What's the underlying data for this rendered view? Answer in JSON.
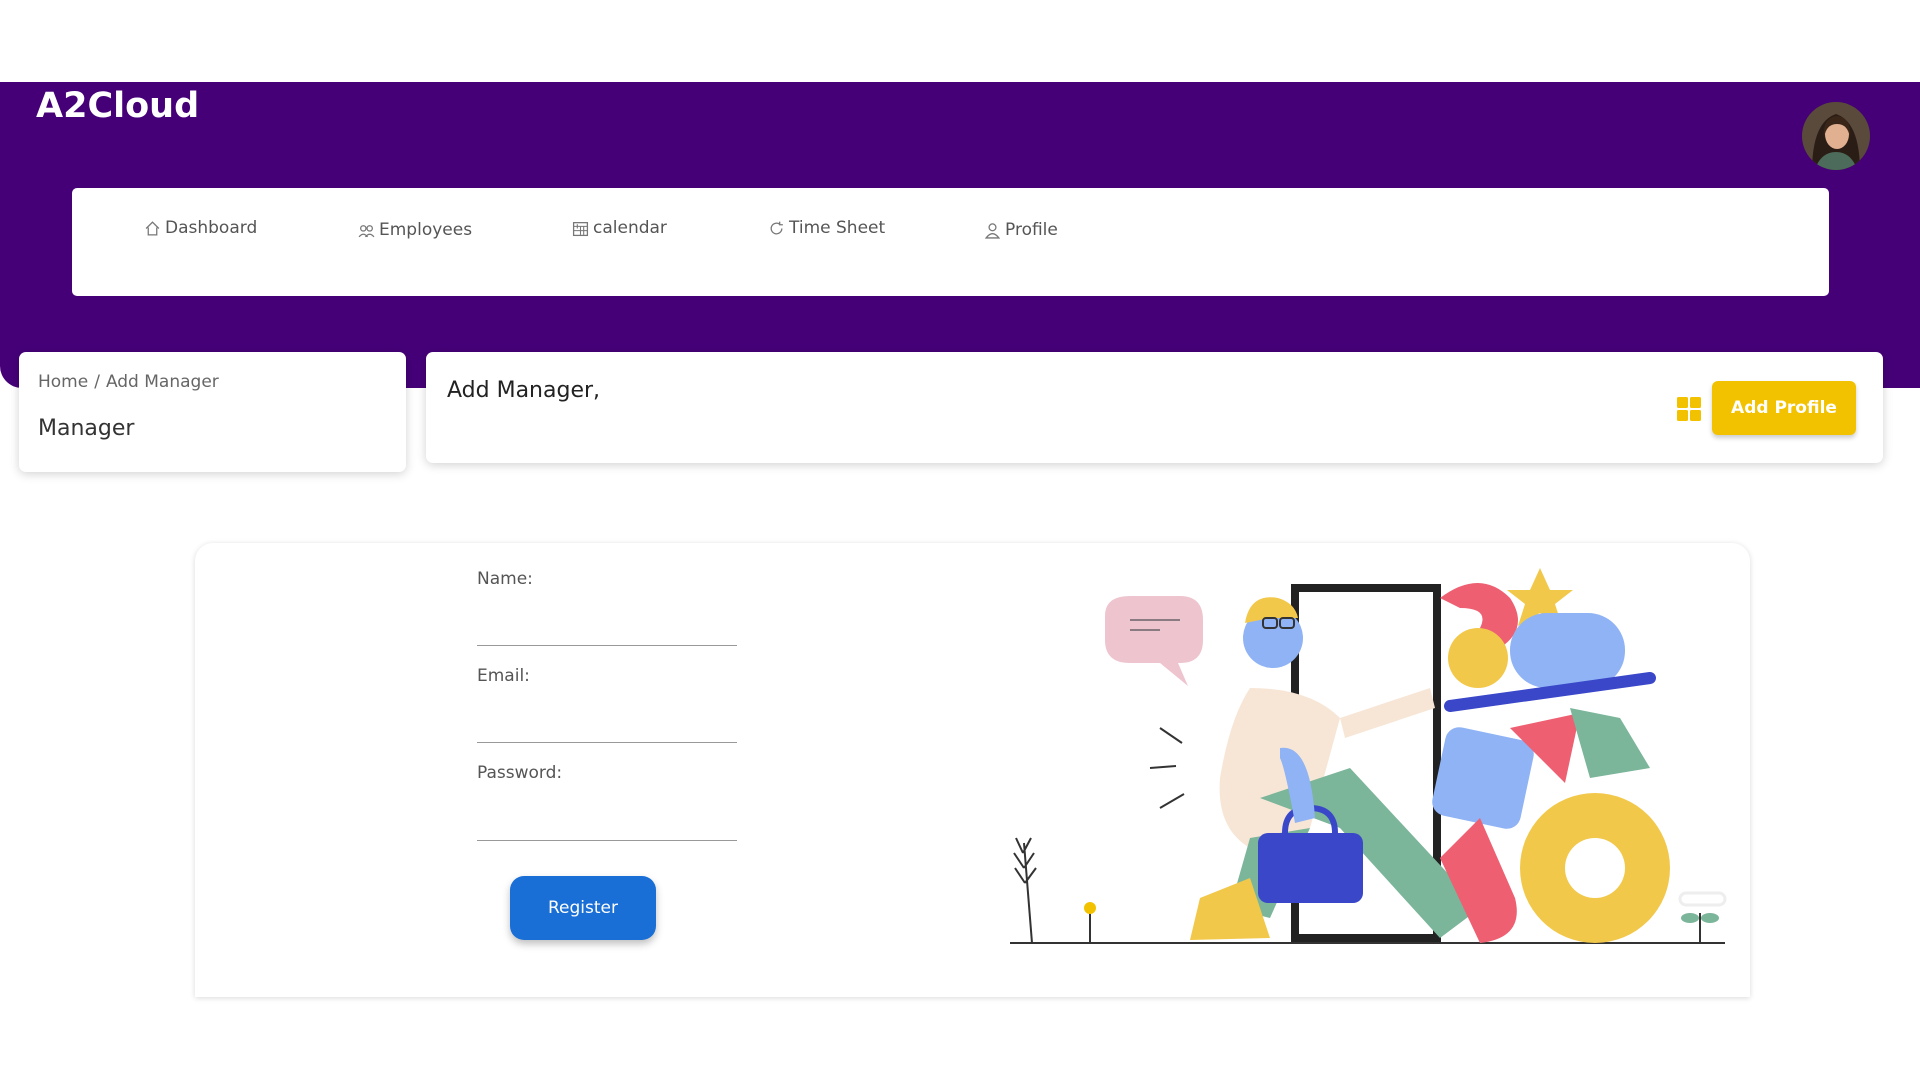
{
  "app": {
    "brand": "A2Cloud"
  },
  "nav": {
    "items": [
      {
        "label": "Dashboard",
        "icon": "home-icon"
      },
      {
        "label": "Employees",
        "icon": "users-icon"
      },
      {
        "label": "calendar",
        "icon": "calendar-icon"
      },
      {
        "label": "Time Sheet",
        "icon": "refresh-icon"
      },
      {
        "label": "Profile",
        "icon": "user-icon"
      }
    ]
  },
  "breadcrumb": {
    "home": "Home",
    "separator": "/",
    "current": "Add Manager",
    "title": "Manager"
  },
  "page": {
    "heading": "Add Manager,"
  },
  "actions": {
    "add_profile": "Add Profile",
    "grid_icon": "grid-icon"
  },
  "form": {
    "name_label": "Name:",
    "email_label": "Email:",
    "password_label": "Password:",
    "name_value": "",
    "email_value": "",
    "password_value": "",
    "register_label": "Register"
  },
  "colors": {
    "header_bg": "#450078",
    "accent_yellow": "#f2c200",
    "button_blue": "#1a6fd6"
  }
}
